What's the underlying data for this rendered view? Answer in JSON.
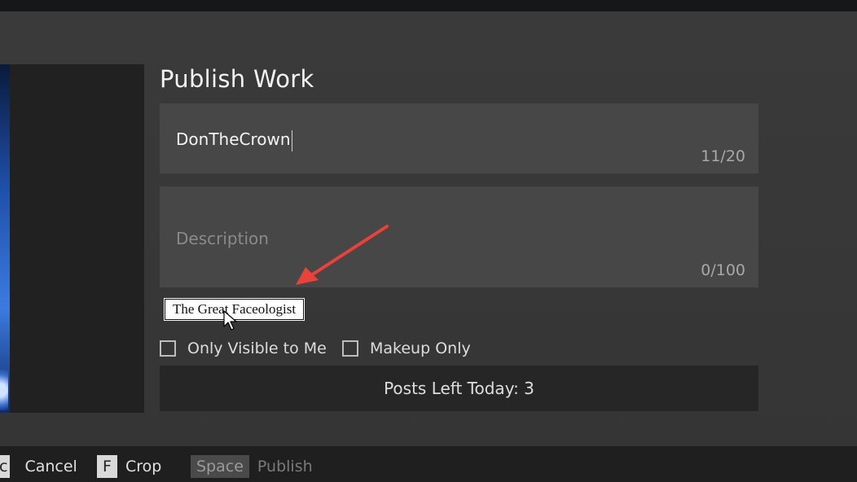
{
  "dialog": {
    "title": "Publish Work"
  },
  "name_field": {
    "value": "DonTheCrown",
    "count": "11/20"
  },
  "description_field": {
    "placeholder": "Description",
    "count": "0/100"
  },
  "tooltip": {
    "text": "The Great Faceologist"
  },
  "options": {
    "only_visible_label": "Only Visible to Me",
    "only_visible_checked": false,
    "makeup_only_label": "Makeup Only",
    "makeup_only_checked": false
  },
  "posts_left": {
    "text": "Posts Left Today: 3"
  },
  "footer": {
    "hints": [
      {
        "key": "c",
        "label": "Cancel"
      },
      {
        "key": "F",
        "label": "Crop"
      },
      {
        "key": "Space",
        "label": "Publish"
      }
    ]
  },
  "colors": {
    "annotation_arrow": "#e8423a",
    "panel": "#383838",
    "field": "#474747",
    "button": "#262626"
  },
  "icons": {
    "cursor": "mouse-pointer-icon",
    "annotation": "red-arrow-annotation-icon"
  }
}
